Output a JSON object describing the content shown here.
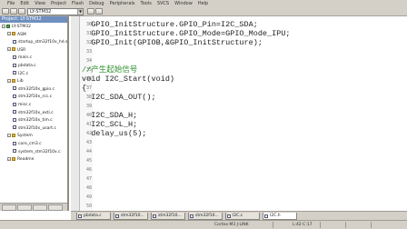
{
  "menu": [
    "File",
    "Edit",
    "View",
    "Project",
    "Flash",
    "Debug",
    "Peripherals",
    "Tools",
    "SVCS",
    "Window",
    "Help"
  ],
  "toolbar": {
    "target": "LY-STM32"
  },
  "project": {
    "title": "Project: LY-STM32",
    "items": [
      {
        "label": "LY-STM32",
        "type": "target",
        "level": 0
      },
      {
        "label": "ASM",
        "type": "folder",
        "level": 1
      },
      {
        "label": "startup_stm32f10x_hd.s",
        "type": "file",
        "level": 2
      },
      {
        "label": "USR",
        "type": "folder",
        "level": 1
      },
      {
        "label": "main.c",
        "type": "file",
        "level": 2
      },
      {
        "label": "pbdata.c",
        "type": "file",
        "level": 2
      },
      {
        "label": "I2C.c",
        "type": "file",
        "level": 2
      },
      {
        "label": "Lib",
        "type": "folder",
        "level": 1
      },
      {
        "label": "stm32f10x_gpio.c",
        "type": "file",
        "level": 2
      },
      {
        "label": "stm32f10x_rcc.c",
        "type": "file",
        "level": 2
      },
      {
        "label": "misc.c",
        "type": "file",
        "level": 2
      },
      {
        "label": "stm32f10x_exti.c",
        "type": "file",
        "level": 2
      },
      {
        "label": "stm32f10x_tim.c",
        "type": "file",
        "level": 2
      },
      {
        "label": "stm32f10x_usart.c",
        "type": "file",
        "level": 2
      },
      {
        "label": "System",
        "type": "folder",
        "level": 1
      },
      {
        "label": "core_cm3.c",
        "type": "file",
        "level": 2
      },
      {
        "label": "system_stm32f10x.c",
        "type": "file",
        "level": 2
      },
      {
        "label": "Readme",
        "type": "folder",
        "level": 1
      }
    ]
  },
  "editor": {
    "lines": [
      {
        "num": "30",
        "text": "  GPIO_InitStructure.GPIO_Pin=I2C_SDA;",
        "style": "normal"
      },
      {
        "num": "31",
        "text": "  GPIO_InitStructure.GPIO_Mode=GPIO_Mode_IPU;",
        "style": "normal"
      },
      {
        "num": "32",
        "text": "  GPIO_Init(GPIOB,&GPIO_InitStructure);",
        "style": "normal"
      },
      {
        "num": "33",
        "text": "",
        "style": "normal"
      },
      {
        "num": "34",
        "text": "",
        "style": "normal"
      },
      {
        "num": "35",
        "text": "//产生起始信号",
        "style": "comment"
      },
      {
        "num": "36",
        "text": "void I2C_Start(void)",
        "style": "normal"
      },
      {
        "num": "37",
        "text": "{",
        "style": "normal"
      },
      {
        "num": "38",
        "text": "  I2C_SDA_OUT();",
        "style": "normal"
      },
      {
        "num": "39",
        "text": "",
        "style": "normal"
      },
      {
        "num": "40",
        "text": "  I2C_SDA_H;",
        "style": "normal"
      },
      {
        "num": "41",
        "text": "  I2C_SCL_H;",
        "style": "normal"
      },
      {
        "num": "42",
        "text": "  delay_us(5);",
        "style": "normal"
      },
      {
        "num": "43",
        "text": "",
        "style": "normal"
      },
      {
        "num": "44",
        "text": "",
        "style": "normal"
      },
      {
        "num": "45",
        "text": "",
        "style": "normal"
      },
      {
        "num": "46",
        "text": "",
        "style": "normal"
      },
      {
        "num": "47",
        "text": "",
        "style": "normal"
      },
      {
        "num": "48",
        "text": "",
        "style": "normal"
      },
      {
        "num": "49",
        "text": "",
        "style": "normal"
      },
      {
        "num": "50",
        "text": "",
        "style": "normal"
      }
    ]
  },
  "file_tabs": [
    {
      "label": "pbdata.c",
      "active": false
    },
    {
      "label": "stm32f10...",
      "active": false
    },
    {
      "label": "stm32f10...",
      "active": false
    },
    {
      "label": "stm32f10...",
      "active": false
    },
    {
      "label": "I2C.c",
      "active": false
    },
    {
      "label": "I2C.h",
      "active": true
    }
  ],
  "status": {
    "debugger": "Cortex-M3 J-LINK",
    "position": "L:42 C:17"
  }
}
